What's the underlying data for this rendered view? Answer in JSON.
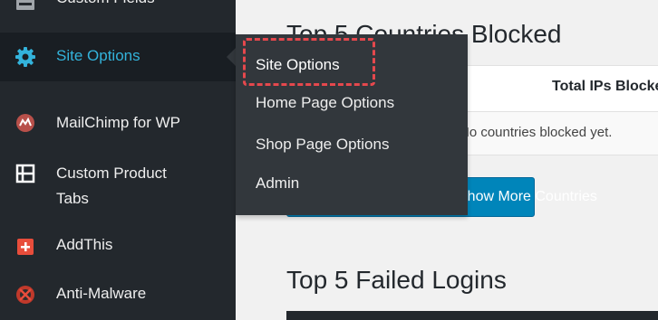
{
  "sidebar": {
    "items": [
      {
        "key": "custom-fields",
        "label": "Custom Fields",
        "icon": "custom-fields-icon"
      },
      {
        "key": "site-options",
        "label": "Site Options",
        "icon": "gear-icon",
        "active": true
      },
      {
        "key": "mailchimp",
        "label": "MailChimp for WP",
        "icon": "mailchimp-icon"
      },
      {
        "key": "custom-product-tabs",
        "label": "Custom Product Tabs",
        "label_lines": [
          "Custom Product",
          "Tabs"
        ],
        "icon": "tabs-icon"
      },
      {
        "key": "addthis",
        "label": "AddThis",
        "icon": "plus-icon"
      },
      {
        "key": "anti-malware",
        "label": "Anti-Malware",
        "icon": "anti-malware-icon"
      }
    ]
  },
  "submenu": {
    "items": [
      {
        "label": "Site Options",
        "highlighted": true
      },
      {
        "label": "Home Page Options"
      },
      {
        "label": "Shop Page Options"
      },
      {
        "label": "Admin"
      }
    ]
  },
  "main": {
    "section1_title": "Top 5 Countries Blocked",
    "table_column_title": "Total IPs Blocked",
    "table_empty_text": "No countries blocked yet.",
    "button_label": "Show More Countries",
    "section2_title": "Top 5 Failed Logins"
  },
  "colors": {
    "sidebar_bg": "#23282d",
    "active_item_bg": "#191e23",
    "active_text": "#33b3db",
    "submenu_bg": "#32373c",
    "highlight": "#e5484d",
    "button_bg": "#0085ba",
    "content_bg": "#f1f1f1"
  }
}
